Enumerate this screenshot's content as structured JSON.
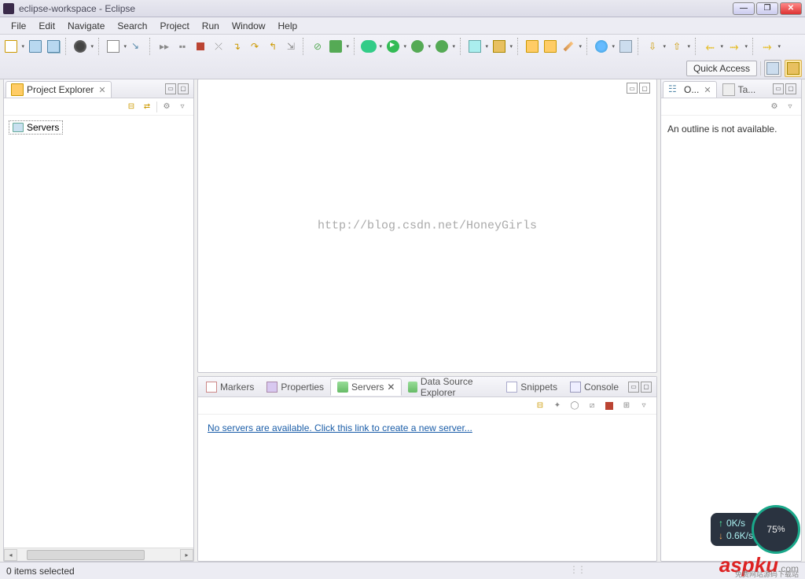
{
  "window": {
    "title": "eclipse-workspace - Eclipse"
  },
  "menu": {
    "file": "File",
    "edit": "Edit",
    "navigate": "Navigate",
    "search": "Search",
    "project": "Project",
    "run": "Run",
    "window": "Window",
    "help": "Help"
  },
  "quick_access_label": "Quick Access",
  "project_explorer": {
    "title": "Project Explorer",
    "tree": {
      "servers": "Servers"
    }
  },
  "editor": {
    "watermark": "http://blog.csdn.net/HoneyGirls"
  },
  "outline": {
    "tab1": "O...",
    "tab2": "Ta...",
    "message": "An outline is not available."
  },
  "bottom": {
    "tabs": {
      "markers": "Markers",
      "properties": "Properties",
      "servers": "Servers",
      "dse": "Data Source Explorer",
      "snippets": "Snippets",
      "console": "Console"
    },
    "servers_link": "No servers are available. Click this link to create a new server..."
  },
  "status": {
    "text": "0 items selected"
  },
  "net_widget": {
    "up": "0K/s",
    "down": "0.6K/s"
  },
  "circle_widget": {
    "value": "75",
    "pct": "%"
  },
  "brand": {
    "text": "aspku",
    "dotcom": ".com",
    "sub": "免费网站源码下载站"
  }
}
